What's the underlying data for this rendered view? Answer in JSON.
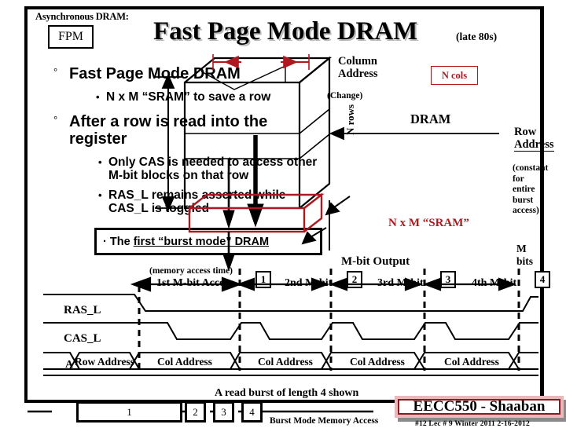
{
  "header": {
    "async_label": "Asynchronous DRAM:",
    "fpm_badge": "FPM",
    "title": "Fast Page Mode DRAM",
    "era": "(late 80s)"
  },
  "bullets": {
    "level1_a": "Fast Page Mode DRAM",
    "level2_a": "N x M “SRAM” to save a row",
    "level1_b": "After a row is read into the register",
    "level2_b": "Only CAS is needed to access other M-bit blocks on that row",
    "level2_c": "RAS_L remains asserted while CAS_L is toggled",
    "boxed_prefix": "The ",
    "boxed_underlined": "first “burst mode” DRAM",
    "bullet_marker_l1": "°",
    "bullet_marker_l2": "•",
    "bullet_marker_l3": "·"
  },
  "diagram": {
    "column_address": "Column\nAddress",
    "column_address_l1": "Column",
    "column_address_l2": "Address",
    "change": "(Change)",
    "n_cols": "N cols",
    "n_rows": "N rows",
    "dram": "DRAM",
    "row_address_l1": "Row",
    "row_address_l2": "Address",
    "row_constant": "(constant\nfor entire\nburst access)",
    "row_constant_l1": "(constant",
    "row_constant_l2": "for entire",
    "row_constant_l3": "burst access)",
    "sram": "N x M “SRAM”",
    "m_bits": "M bits",
    "m_bit_output": "M-bit Output",
    "accent_red": "#b01820"
  },
  "timing": {
    "memory_access_time": "(memory access time)",
    "access_labels": [
      "1st M-bit Access",
      "2nd M-bit",
      "3rd M-bit",
      "4th M-bit"
    ],
    "markers": [
      "1",
      "2",
      "3",
      "4"
    ],
    "signals": [
      "RAS_L",
      "CAS_L",
      "A"
    ],
    "bus_values": [
      "Row Address",
      "Col Address",
      "Col Address",
      "Col Address",
      "Col Address"
    ]
  },
  "bottom": {
    "read_burst": "A read burst of length 4 shown",
    "burst_boxes": [
      "1",
      "2",
      "3",
      "4"
    ],
    "burst_mode_label": "Burst Mode Memory Access",
    "course_badge": "EECC550 - Shaaban",
    "footer_meta": "#12   Lec # 9   Winter 2011  2-16-2012",
    "badge_border": "#8a1a22"
  }
}
